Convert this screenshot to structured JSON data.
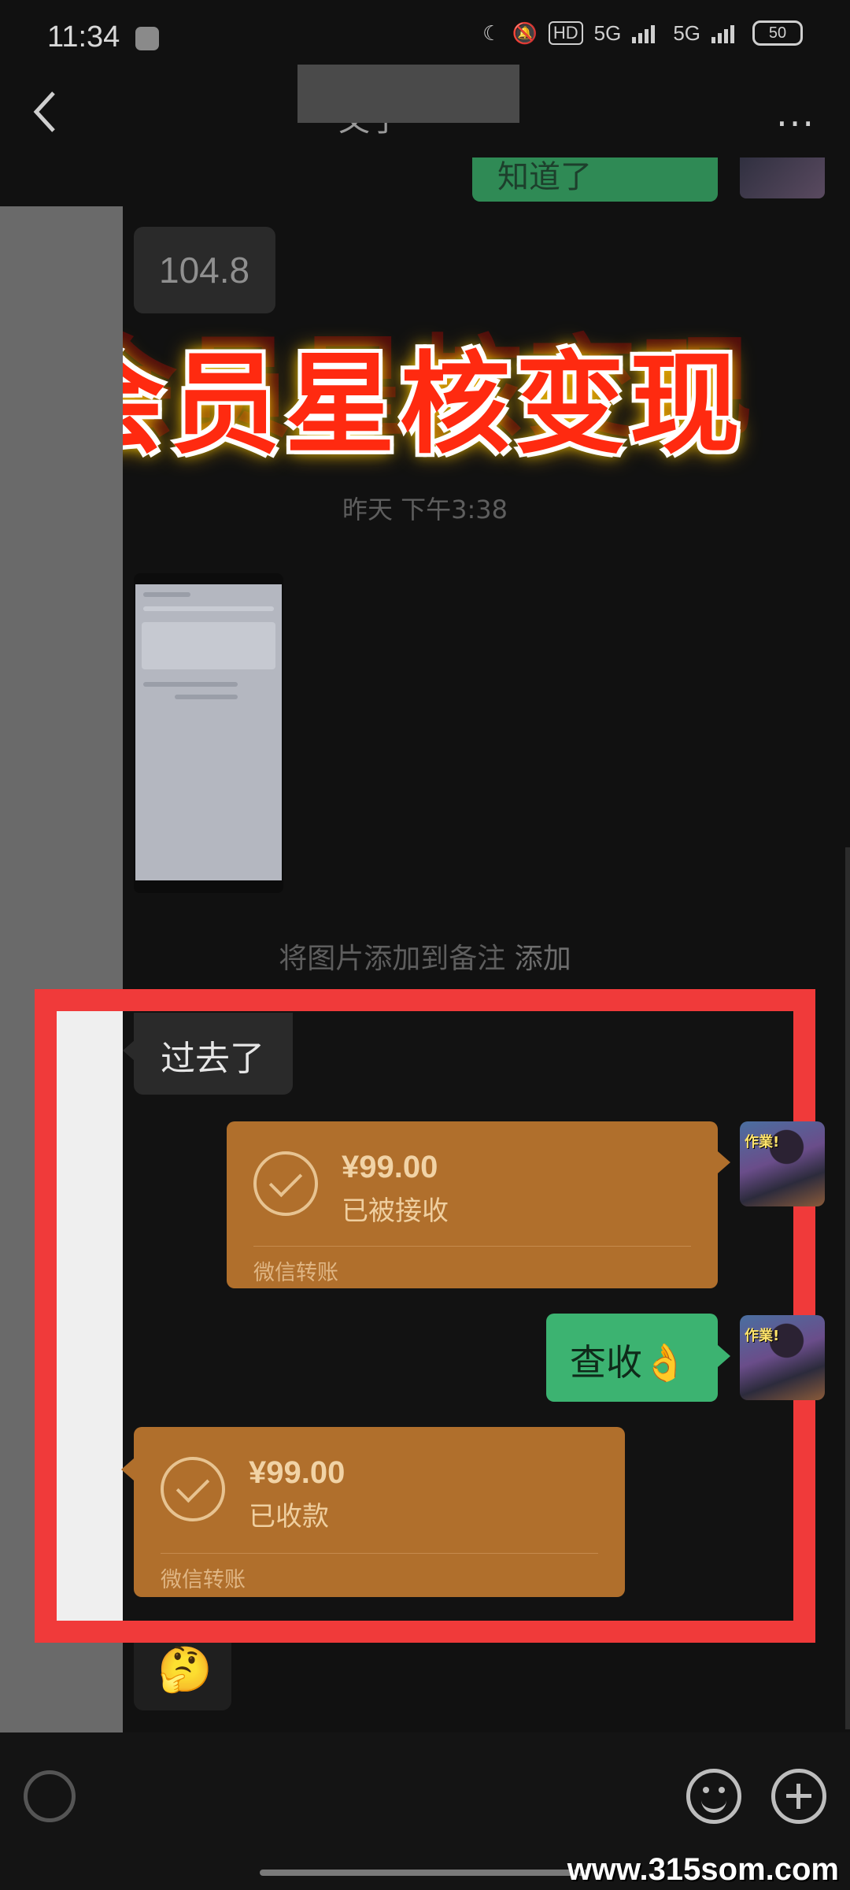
{
  "status_bar": {
    "time": "11:34",
    "hd_label": "HD",
    "net1": "5G",
    "net2": "5G",
    "battery": "50"
  },
  "header": {
    "title_partial": "又了",
    "more_label": "···"
  },
  "chat": {
    "top_sent_partial": "知道了",
    "received_number": "104.8",
    "banner": "会员星核变现",
    "timestamp": "昨天 下午3:38",
    "add_note_prefix": "将图片添加到备注",
    "add_note_link": "添加",
    "received_text": "过去了",
    "transfer_sent": {
      "amount": "¥99.00",
      "status": "已被接收",
      "footer": "微信转账"
    },
    "sent_text": "查收👌",
    "transfer_received": {
      "amount": "¥99.00",
      "status": "已收款",
      "footer": "微信转账"
    },
    "emoji": "🤔"
  },
  "avatar_caption": "作業!",
  "watermark": "www.315som.com",
  "colors": {
    "transfer": "#b06f2c",
    "sent_bubble": "#3cb371",
    "highlight_frame": "#f03a3a",
    "banner_text": "#ff2a10"
  }
}
